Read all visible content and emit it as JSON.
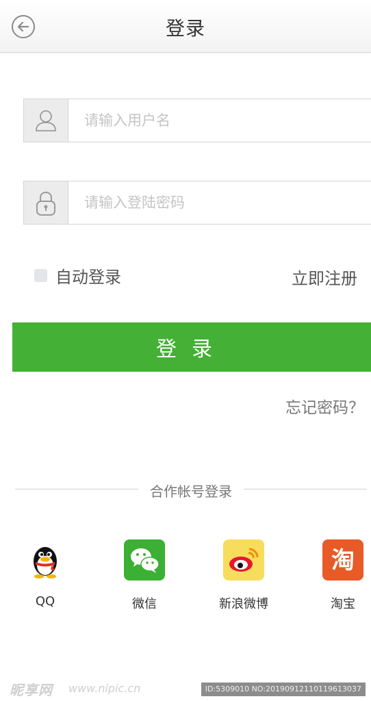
{
  "header": {
    "title": "登录",
    "back_icon": "arrow-left-circle-icon"
  },
  "form": {
    "username": {
      "icon": "user-icon",
      "placeholder": "请输入用户名",
      "value": ""
    },
    "password": {
      "icon": "lock-icon",
      "placeholder": "请输入登陆密码",
      "value": ""
    },
    "auto_login": {
      "label": "自动登录",
      "checked": false
    },
    "register_label": "立即注册",
    "login_button_label": "登录",
    "forgot_label": "忘记密码？"
  },
  "partners": {
    "title": "合作帐号登录",
    "items": [
      {
        "label": "QQ",
        "icon": "qq-penguin-icon"
      },
      {
        "label": "微信",
        "icon": "wechat-icon",
        "color": "#3cb034"
      },
      {
        "label": "新浪微博",
        "icon": "weibo-icon",
        "color": "#f5d54a"
      },
      {
        "label": "淘宝",
        "icon": "taobao-icon",
        "color": "#e85a26"
      }
    ]
  },
  "colors": {
    "accent": "#44b035",
    "field_border": "#d4d4d4",
    "icon_box": "#ececec"
  },
  "watermark": {
    "logo": "昵享网",
    "url": "www.nipic.cn",
    "id": "ID:5309010 NO:20190912110119613037"
  }
}
